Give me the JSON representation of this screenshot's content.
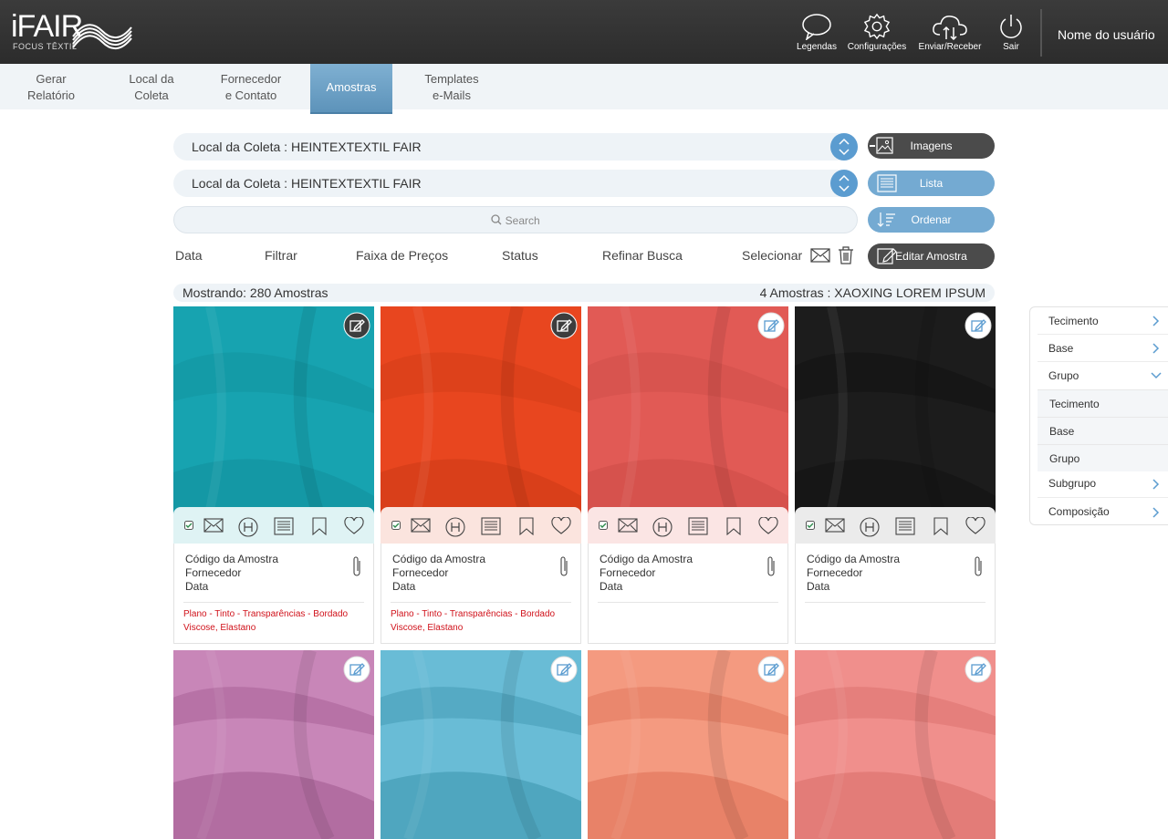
{
  "header": {
    "logo_text": "iFAIR",
    "logo_sub": "FOCUS TÊXTIL",
    "buttons": [
      {
        "label": "Legendas",
        "icon": "speech-bubble-icon"
      },
      {
        "label": "Configurações",
        "icon": "gear-icon"
      },
      {
        "label": "Enviar/Receber",
        "icon": "cloud-sync-icon"
      },
      {
        "label": "Sair",
        "icon": "power-icon"
      }
    ],
    "user_name": "Nome do usuário"
  },
  "nav": {
    "tabs": [
      {
        "label": "Gerar\nRelatório"
      },
      {
        "label": "Local da\nColeta"
      },
      {
        "label": "Fornecedor\ne Contato"
      },
      {
        "label": "Amostras"
      },
      {
        "label": "Templates\ne-Mails"
      }
    ],
    "active": "Amostras"
  },
  "selectors": [
    {
      "label": "Local da Coleta :  HEINTEXTEXTIL FAIR"
    },
    {
      "label": "Local da Coleta :  HEINTEXTEXTIL FAIR"
    }
  ],
  "search": {
    "placeholder": "Search"
  },
  "right_buttons": {
    "imagens": "Imagens",
    "lista": "Lista",
    "ordenar": "Ordenar",
    "editar": "Editar Amostra"
  },
  "filters": {
    "data": "Data",
    "filtrar": "Filtrar",
    "faixa": "Faixa de Preços",
    "status": "Status",
    "refinar": "Refinar Busca",
    "selecionar": "Selecionar"
  },
  "info": {
    "showing": "Mostrando: 280 Amostras",
    "group": "4 Amostras : XAOXING LOREM IPSUM"
  },
  "samples": [
    {
      "color": "#17a3b0",
      "shade": "#0e7f8a",
      "edit_style": "dark",
      "bar": "#dff3f4",
      "code": "Código da Amostra",
      "supplier": "Fornecedor",
      "date": "Data",
      "tags1": "Plano - Tinto - Transparências - Bordado",
      "tags2": "Viscose, Elastano"
    },
    {
      "color": "#e8461f",
      "shade": "#b5300f",
      "edit_style": "dark",
      "bar": "#fbe4de",
      "code": "Código da Amostra",
      "supplier": "Fornecedor",
      "date": "Data",
      "tags1": "Plano - Tinto - Transparências - Bordado",
      "tags2": "Viscose, Elastano"
    },
    {
      "color": "#e15a55",
      "shade": "#b93e3a",
      "edit_style": "light",
      "bar": "#fbe5e4",
      "code": "Código da Amostra",
      "supplier": "Fornecedor",
      "date": "Data",
      "tags1": "",
      "tags2": ""
    },
    {
      "color": "#1c1c1c",
      "shade": "#060606",
      "edit_style": "light",
      "bar": "#ebebeb",
      "code": "Código da Amostra",
      "supplier": "Fornecedor",
      "date": "Data",
      "tags1": "",
      "tags2": ""
    }
  ],
  "samples_row2": [
    {
      "color": "#c886b8",
      "shade": "#7a2f69"
    },
    {
      "color": "#69bcd6",
      "shade": "#0e6f84"
    },
    {
      "color": "#f49a80",
      "shade": "#c8442a"
    },
    {
      "color": "#f08f8c",
      "shade": "#c14b46"
    }
  ],
  "sidebar": {
    "items": [
      "Tecimento",
      "Base",
      "Grupo"
    ],
    "subitems": [
      "Tecimento",
      "Base",
      "Grupo"
    ],
    "items_after": [
      "Subgrupo",
      "Composição"
    ]
  }
}
